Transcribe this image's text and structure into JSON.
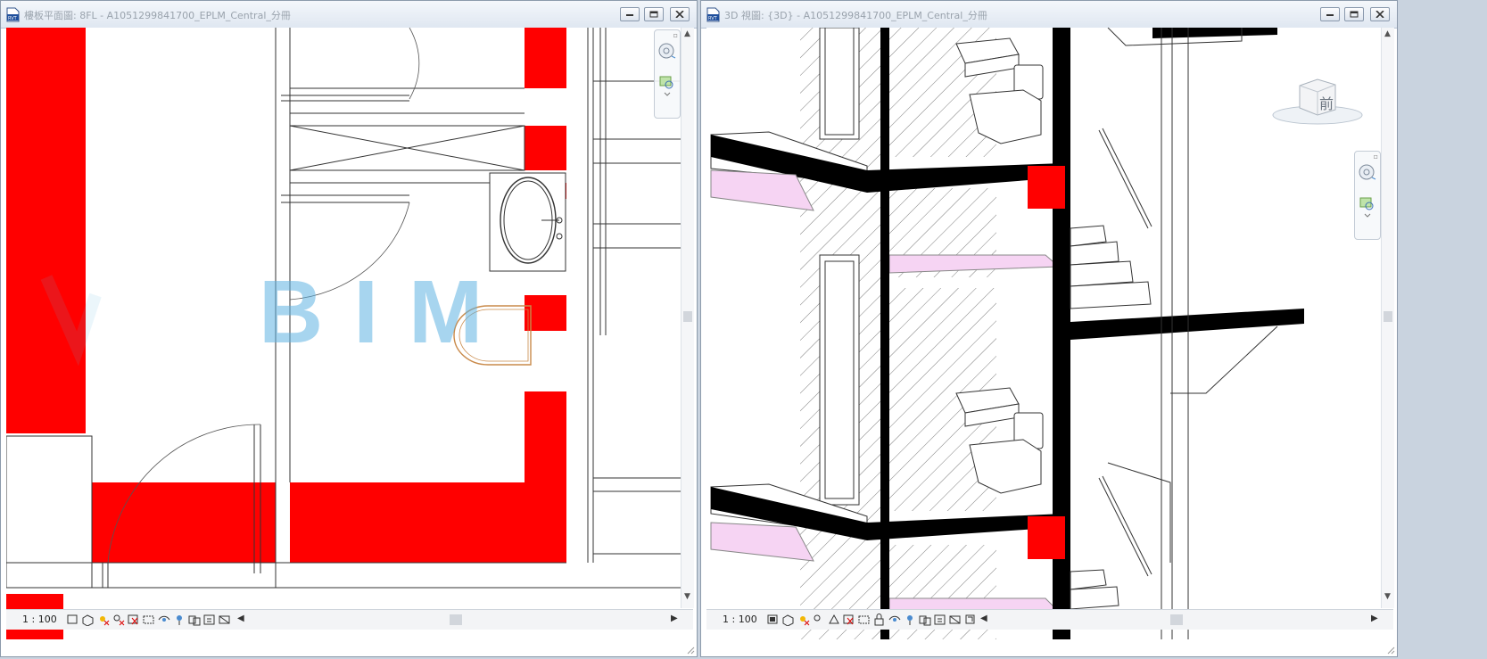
{
  "left_view": {
    "title": "樓板平面圖: 8FL - A1051299841700_EPLM_Central_分冊",
    "scale": "1 : 100",
    "watermark": "BIM"
  },
  "right_view": {
    "title": "3D 視圖: {3D} - A1051299841700_EPLM_Central_分冊",
    "scale": "1 : 100",
    "viewcube_face": "前"
  },
  "window_buttons": [
    "minimize-icon",
    "restore-icon",
    "close-icon"
  ],
  "colors": {
    "cut_wall_red": "#ff0000",
    "section_black": "#000000",
    "watermark_blue": "#5eb2e2",
    "titlebar_text": "#9aa3ad",
    "floor_magenta": "#f2c9f0"
  }
}
